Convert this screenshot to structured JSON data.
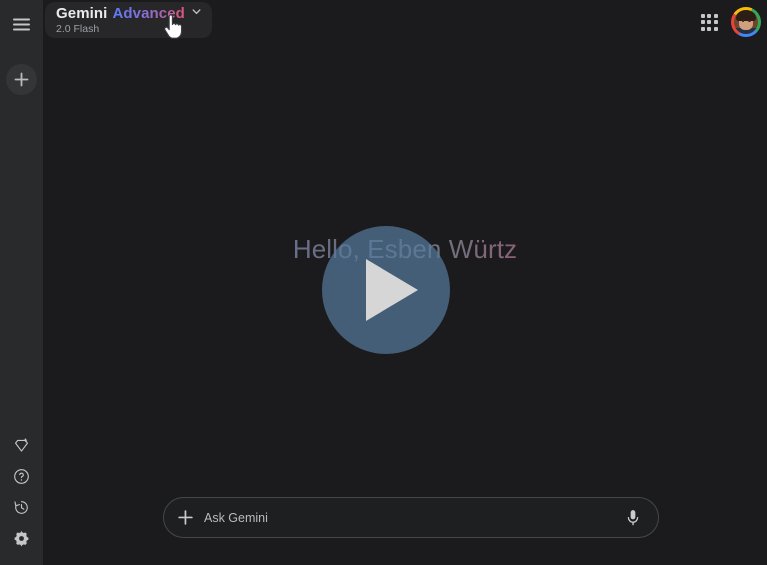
{
  "app": {
    "name": "Gemini",
    "background": "#1b1b1d",
    "sidebar_background": "#282a2c"
  },
  "sidebar": {
    "menu_label": "Main menu",
    "new_chat_label": "New chat",
    "items_bottom": [
      {
        "icon": "gem-icon",
        "label": "Gems"
      },
      {
        "icon": "help-icon",
        "label": "Help"
      },
      {
        "icon": "history-icon",
        "label": "Activity"
      },
      {
        "icon": "settings-gear-icon",
        "label": "Settings"
      }
    ]
  },
  "topbar": {
    "model": {
      "name": "Gemini",
      "tier": "Advanced",
      "sublabel": "2.0 Flash",
      "tier_gradient_start": "#5c7cfa",
      "tier_gradient_end": "#d8567a",
      "chevron": "chevron-down-icon"
    },
    "apps_label": "Google apps",
    "avatar_label": "Google Account",
    "avatar_ring_colors": [
      "#4285f4",
      "#ea4335",
      "#fbbc05",
      "#34a853"
    ]
  },
  "main": {
    "greeting": "Hello, Esben Würtz",
    "greeting_gradient_start": "#4a6ee0",
    "greeting_gradient_end": "#e0536f",
    "play_overlay": {
      "label": "Play",
      "circle_color": "#567aa0",
      "triangle_color": "#d6d6d6"
    }
  },
  "composer": {
    "placeholder": "Ask Gemini",
    "value": "",
    "add_label": "Add files",
    "mic_label": "Use microphone"
  },
  "cursor": {
    "type": "pointer-hand-cursor"
  }
}
